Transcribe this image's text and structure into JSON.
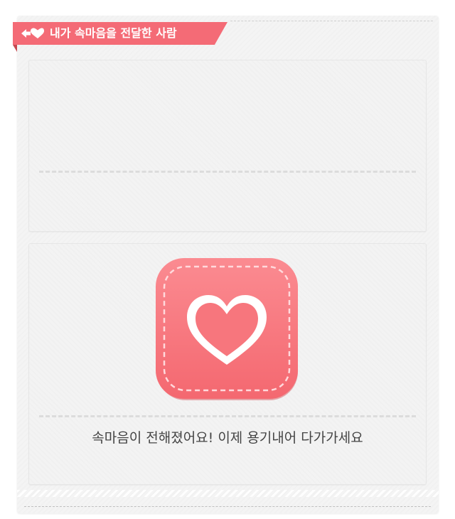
{
  "header": {
    "title": "내가 속마음을 전달한 사람",
    "icon": "heart-arrow-icon"
  },
  "status": {
    "message": "속마음이 전해졌어요! 이제 용기내어 다가가세요",
    "icon": "stitched-heart-icon"
  },
  "colors": {
    "accent": "#f46b76",
    "badge": "#f7767d",
    "text": "#444444"
  }
}
